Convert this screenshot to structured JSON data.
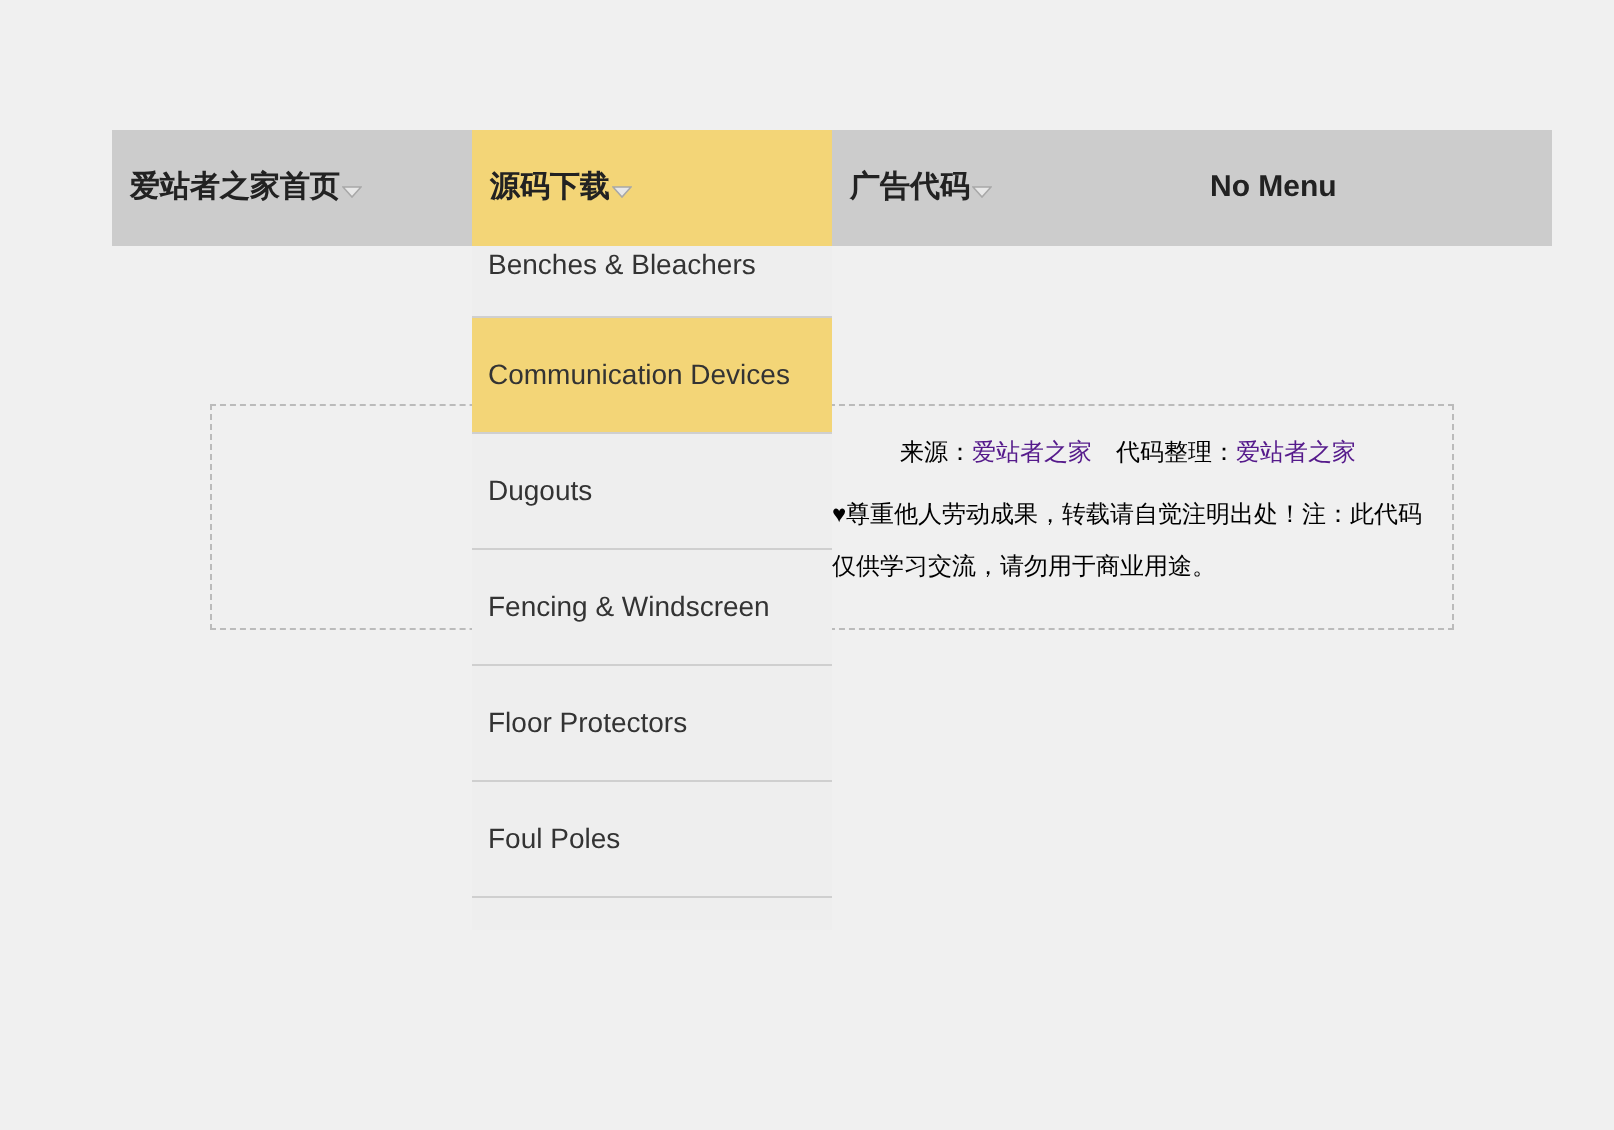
{
  "nav": [
    {
      "label": "爱站者之家首页",
      "has_dropdown": true,
      "selected": false
    },
    {
      "label": "源码下载",
      "has_dropdown": true,
      "selected": true
    },
    {
      "label": "广告代码",
      "has_dropdown": true,
      "selected": false
    },
    {
      "label": "No Menu",
      "has_dropdown": false,
      "selected": false
    }
  ],
  "dropdown": [
    {
      "label": "Benches & Bleachers",
      "selected": false
    },
    {
      "label": "Communication Devices",
      "selected": true
    },
    {
      "label": "Dugouts",
      "selected": false
    },
    {
      "label": "Fencing & Windscreen",
      "selected": false
    },
    {
      "label": "Floor Protectors",
      "selected": false
    },
    {
      "label": "Foul Poles",
      "selected": false
    }
  ],
  "info": {
    "source_label": "来源：",
    "source_link": "爱站者之家",
    "editor_label": "代码整理：",
    "editor_link": "爱站者之家",
    "notice": "♥尊重他人劳动成果，转载请自觉注明出处！注：此代码仅供学习交流，请勿用于商业用途。"
  }
}
